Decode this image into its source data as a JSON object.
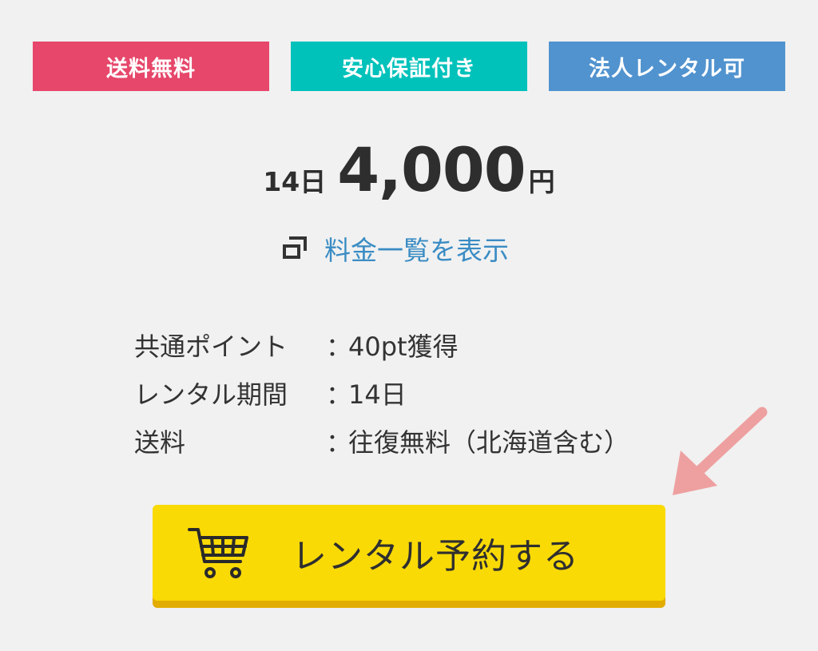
{
  "badges": [
    {
      "label": "送料無料",
      "color": "#e6476a"
    },
    {
      "label": "安心保証付き",
      "color": "#00c2bb"
    },
    {
      "label": "法人レンタル可",
      "color": "#5193cf"
    }
  ],
  "price": {
    "days": "14日",
    "amount": "4,000",
    "currency": "円"
  },
  "fee_link": {
    "icon": "window-icon",
    "label": "料金一覧を表示"
  },
  "info": {
    "separator": "：",
    "rows": [
      {
        "label": "共通ポイント",
        "value": "40pt獲得"
      },
      {
        "label": "レンタル期間",
        "value": "14日"
      },
      {
        "label": "送料",
        "value": "往復無料（北海道含む）"
      }
    ]
  },
  "reserve_button": {
    "icon": "cart-icon",
    "label": "レンタル予約する",
    "color": "#f9da05"
  },
  "arrow": {
    "icon": "arrow-down-left-icon",
    "color": "#eea0a0"
  }
}
